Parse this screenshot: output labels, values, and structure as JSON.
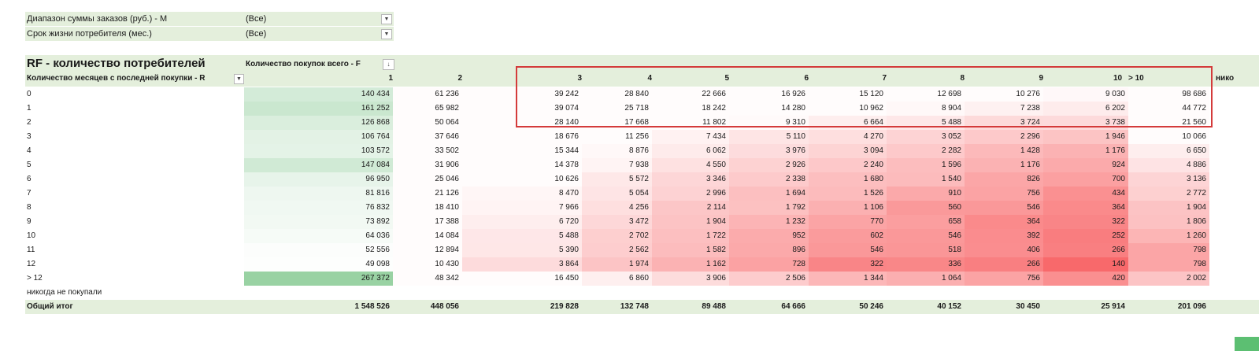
{
  "filters": [
    {
      "label": "Диапазон суммы заказов (руб.) - M",
      "value": "(Все)"
    },
    {
      "label": "Срок жизни потребителя (мес.)",
      "value": "(Все)"
    }
  ],
  "pivot": {
    "title": "RF - количество потребителей",
    "column_field_label": "Количество покупок всего - F",
    "row_field_label": "Количество месяцев с последней покупки - R",
    "columns": [
      "1",
      "2",
      "3",
      "4",
      "5",
      "6",
      "7",
      "8",
      "9",
      "10",
      "> 10",
      "нико"
    ],
    "rows": [
      {
        "label": "0",
        "values": [
          "140 434",
          "61 236",
          "39 242",
          "28 840",
          "22 666",
          "16 926",
          "15 120",
          "12 698",
          "10 276",
          "9 030",
          "98 686"
        ]
      },
      {
        "label": "1",
        "values": [
          "161 252",
          "65 982",
          "39 074",
          "25 718",
          "18 242",
          "14 280",
          "10 962",
          "8 904",
          "7 238",
          "6 202",
          "44 772"
        ]
      },
      {
        "label": "2",
        "values": [
          "126 868",
          "50 064",
          "28 140",
          "17 668",
          "11 802",
          "9 310",
          "6 664",
          "5 488",
          "3 724",
          "3 738",
          "21 560"
        ]
      },
      {
        "label": "3",
        "values": [
          "106 764",
          "37 646",
          "18 676",
          "11 256",
          "7 434",
          "5 110",
          "4 270",
          "3 052",
          "2 296",
          "1 946",
          "10 066"
        ]
      },
      {
        "label": "4",
        "values": [
          "103 572",
          "33 502",
          "15 344",
          "8 876",
          "6 062",
          "3 976",
          "3 094",
          "2 282",
          "1 428",
          "1 176",
          "6 650"
        ]
      },
      {
        "label": "5",
        "values": [
          "147 084",
          "31 906",
          "14 378",
          "7 938",
          "4 550",
          "2 926",
          "2 240",
          "1 596",
          "1 176",
          "924",
          "4 886"
        ]
      },
      {
        "label": "6",
        "values": [
          "96 950",
          "25 046",
          "10 626",
          "5 572",
          "3 346",
          "2 338",
          "1 680",
          "1 540",
          "826",
          "700",
          "3 136"
        ]
      },
      {
        "label": "7",
        "values": [
          "81 816",
          "21 126",
          "8 470",
          "5 054",
          "2 996",
          "1 694",
          "1 526",
          "910",
          "756",
          "434",
          "2 772"
        ]
      },
      {
        "label": "8",
        "values": [
          "76 832",
          "18 410",
          "7 966",
          "4 256",
          "2 114",
          "1 792",
          "1 106",
          "560",
          "546",
          "364",
          "1 904"
        ]
      },
      {
        "label": "9",
        "values": [
          "73 892",
          "17 388",
          "6 720",
          "3 472",
          "1 904",
          "1 232",
          "770",
          "658",
          "364",
          "322",
          "1 806"
        ]
      },
      {
        "label": "10",
        "values": [
          "64 036",
          "14 084",
          "5 488",
          "2 702",
          "1 722",
          "952",
          "602",
          "546",
          "392",
          "252",
          "1 260"
        ]
      },
      {
        "label": "11",
        "values": [
          "52 556",
          "12 894",
          "5 390",
          "2 562",
          "1 582",
          "896",
          "546",
          "518",
          "406",
          "266",
          "798"
        ]
      },
      {
        "label": "12",
        "values": [
          "49 098",
          "10 430",
          "3 864",
          "1 974",
          "1 162",
          "728",
          "322",
          "336",
          "266",
          "140",
          "798"
        ]
      },
      {
        "label": "> 12",
        "values": [
          "267 372",
          "48 342",
          "16 450",
          "6 860",
          "3 906",
          "2 506",
          "1 344",
          "1 064",
          "756",
          "420",
          "2 002"
        ]
      },
      {
        "label": "никогда не покупали",
        "values": [
          "",
          "",
          "",
          "",
          "",
          "",
          "",
          "",
          "",
          "",
          ""
        ]
      }
    ],
    "total": {
      "label": "Общий итог",
      "values": [
        "1 548 526",
        "448 056",
        "219 828",
        "132 748",
        "89 488",
        "64 666",
        "50 246",
        "40 152",
        "30 450",
        "25 914",
        "201 096"
      ]
    }
  },
  "colors": {
    "header_band": "#e4efdc",
    "highlight_border": "#d43b3b",
    "heat_high": "#f8696b",
    "heat_green": "#63be7b"
  }
}
